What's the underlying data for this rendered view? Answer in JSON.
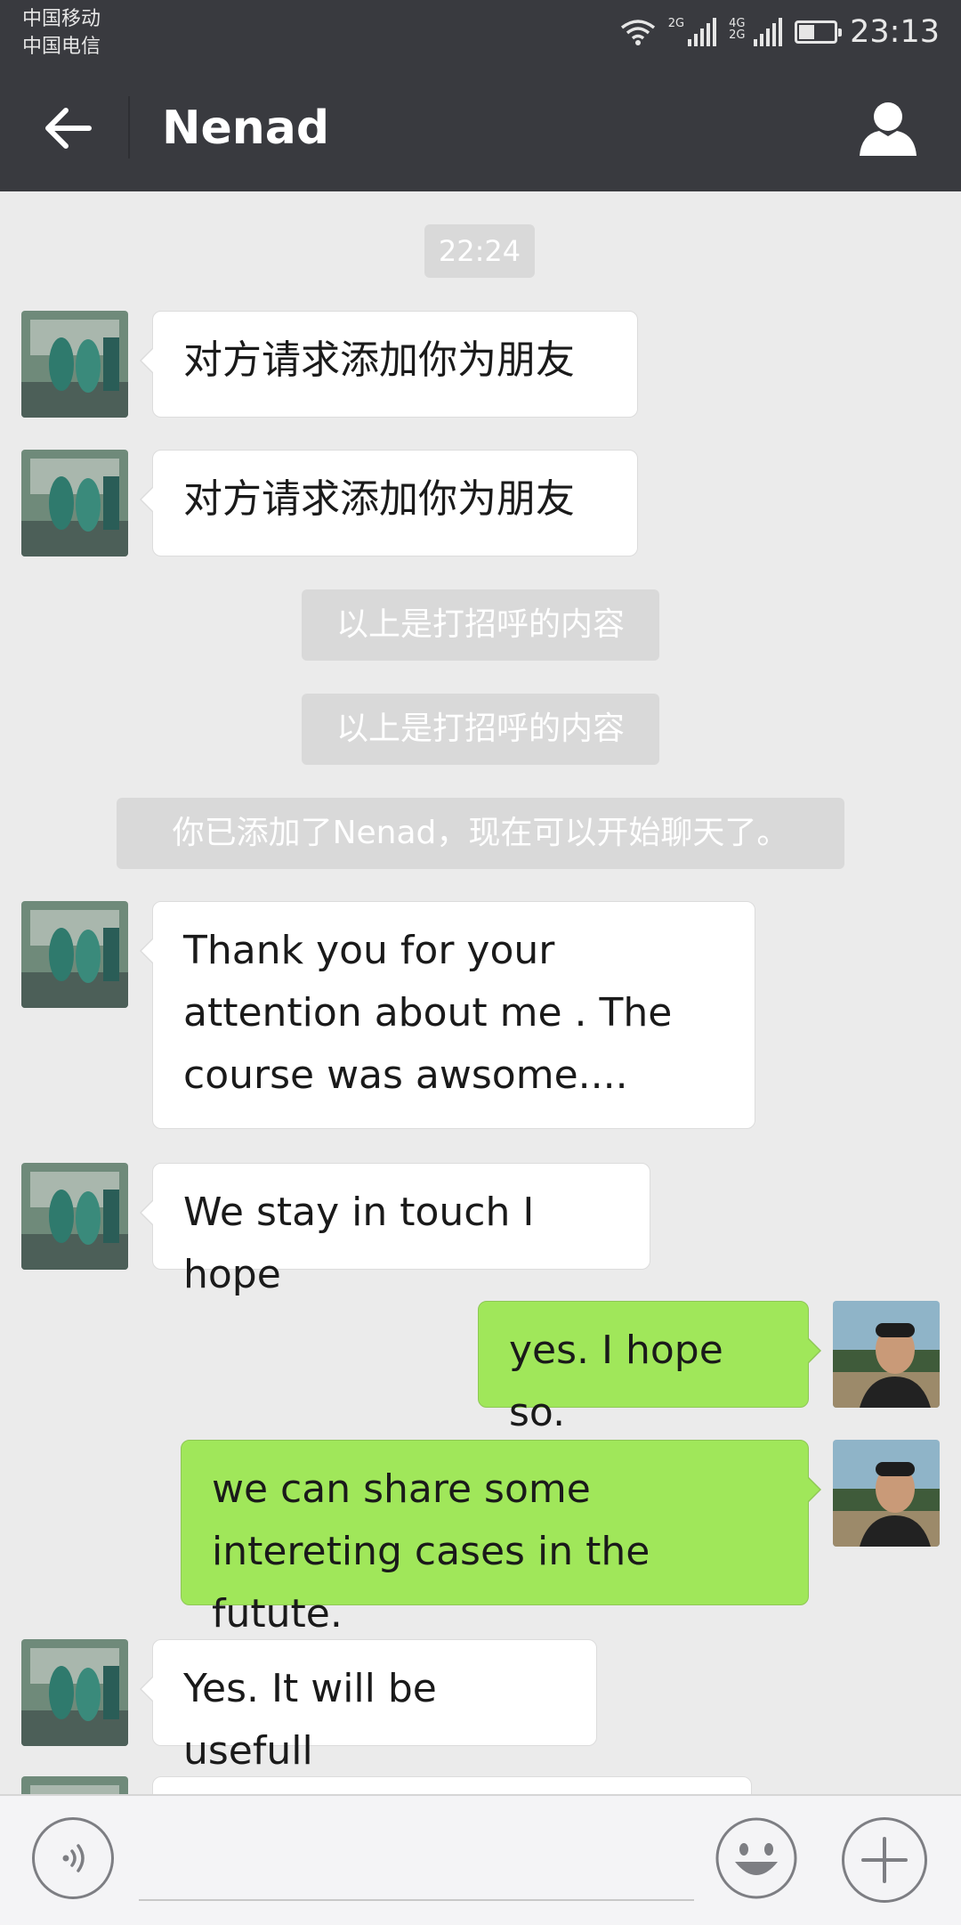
{
  "status_bar": {
    "carrier_1": "中国移动",
    "carrier_2": "中国电信",
    "network_1": "2G",
    "network_2": "4G 2G",
    "battery_level": 0.45,
    "time": "23:13"
  },
  "header": {
    "title": "Nenad",
    "back_icon": "arrow-left-icon",
    "profile_icon": "person-icon"
  },
  "chat": {
    "timestamp": "22:24",
    "system_messages": [
      "以上是打招呼的内容",
      "以上是打招呼的内容",
      "你已添加了Nenad，现在可以开始聊天了。"
    ],
    "messages": [
      {
        "sender": "contact",
        "text": "对方请求添加你为朋友"
      },
      {
        "sender": "contact",
        "text": "对方请求添加你为朋友"
      },
      {
        "sender": "contact",
        "text": "Thank you for your attention about me . The course was awsome...."
      },
      {
        "sender": "contact",
        "text": "We stay in touch I hope"
      },
      {
        "sender": "me",
        "text": "yes. I hope so."
      },
      {
        "sender": "me",
        "text": "we can share some intereting cases in the futute."
      },
      {
        "sender": "contact",
        "text": "Yes. It will be usefull"
      }
    ]
  },
  "input_bar": {
    "voice_icon": "voice-icon",
    "emoji_icon": "emoji-icon",
    "plus_icon": "plus-icon"
  },
  "colors": {
    "header_bg": "#393a3f",
    "chat_bg": "#ebebeb",
    "incoming_bubble": "#ffffff",
    "outgoing_bubble": "#a0e75a",
    "system_pill": "#d9d9d9"
  }
}
